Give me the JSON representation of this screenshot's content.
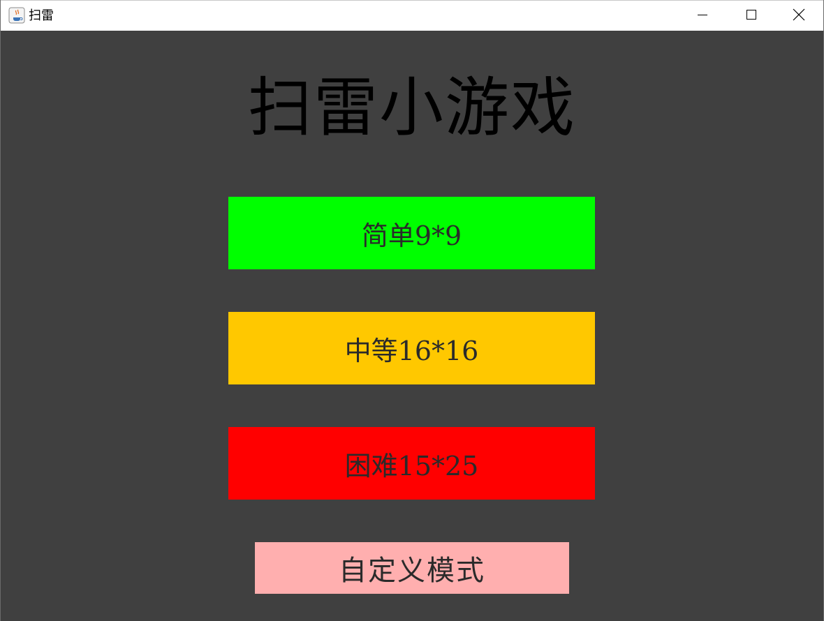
{
  "window": {
    "title": "扫雷",
    "icon": "java-cup-icon",
    "controls": {
      "minimize": "minimize-icon",
      "maximize": "maximize-icon",
      "close": "close-icon"
    }
  },
  "main": {
    "heading": "扫雷小游戏",
    "buttons": [
      {
        "label": "简单9*9",
        "color": "#00ff00"
      },
      {
        "label": "中等16*16",
        "color": "#ffc800"
      },
      {
        "label": "困难15*25",
        "color": "#ff0000"
      },
      {
        "label": "自定义模式",
        "color": "#ffafaf"
      }
    ]
  },
  "colors": {
    "background": "#404040",
    "titlebar": "#ffffff",
    "heading_text": "#000000",
    "button_text": "#2a2a2a"
  }
}
